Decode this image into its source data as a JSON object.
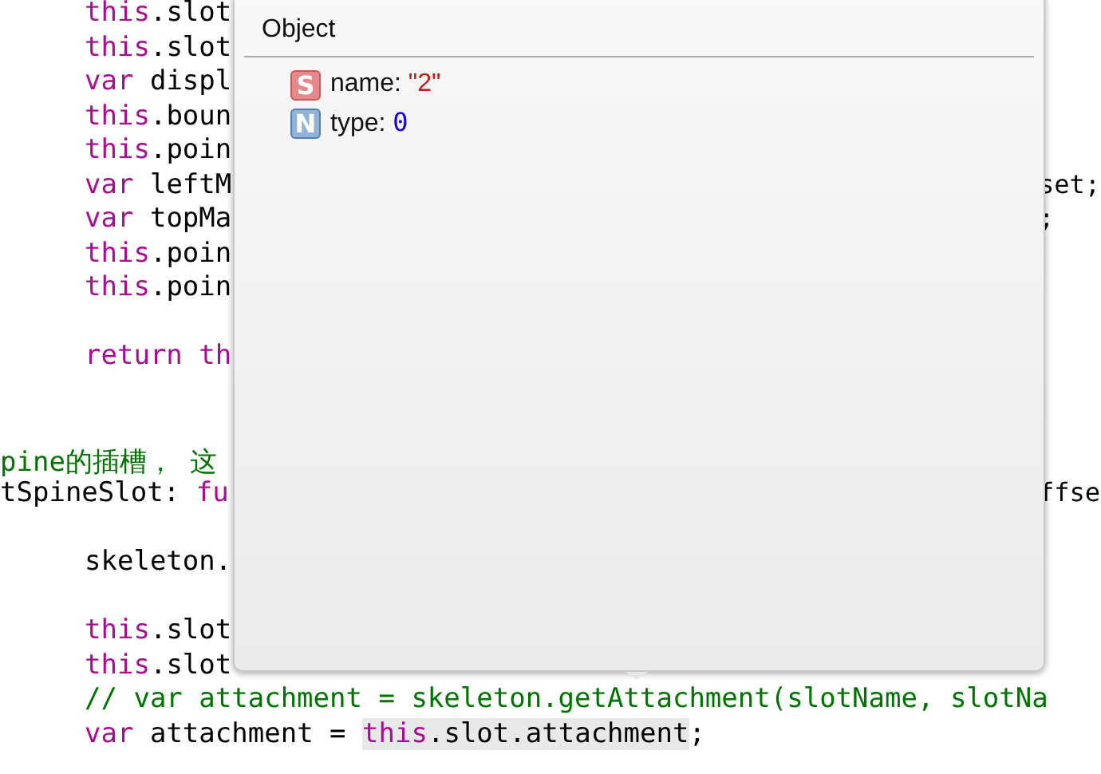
{
  "code_lines": [
    {
      "kind": "code",
      "indented": true,
      "tokens": [
        {
          "text": "this",
          "kind": "keyword"
        },
        {
          "text": ".slot",
          "kind": "plain"
        }
      ]
    },
    {
      "kind": "code",
      "indented": true,
      "tokens": [
        {
          "text": "this",
          "kind": "keyword"
        },
        {
          "text": ".slot",
          "kind": "plain"
        }
      ]
    },
    {
      "kind": "code",
      "indented": true,
      "tokens": [
        {
          "text": "var",
          "kind": "keyword"
        },
        {
          "text": " displ",
          "kind": "plain"
        }
      ]
    },
    {
      "kind": "code",
      "indented": true,
      "tokens": [
        {
          "text": "this",
          "kind": "keyword"
        },
        {
          "text": ".boun",
          "kind": "plain"
        }
      ]
    },
    {
      "kind": "code",
      "indented": true,
      "tokens": [
        {
          "text": "this",
          "kind": "keyword"
        },
        {
          "text": ".poin",
          "kind": "plain"
        }
      ]
    },
    {
      "kind": "code",
      "indented": true,
      "tokens": [
        {
          "text": "var",
          "kind": "keyword"
        },
        {
          "text": " leftM",
          "kind": "plain"
        }
      ],
      "right": "set;"
    },
    {
      "kind": "code",
      "indented": true,
      "tokens": [
        {
          "text": "var",
          "kind": "keyword"
        },
        {
          "text": " topMa",
          "kind": "plain"
        }
      ],
      "right": ";"
    },
    {
      "kind": "code",
      "indented": true,
      "tokens": [
        {
          "text": "this",
          "kind": "keyword"
        },
        {
          "text": ".poin",
          "kind": "plain"
        }
      ]
    },
    {
      "kind": "code",
      "indented": true,
      "tokens": [
        {
          "text": "this",
          "kind": "keyword"
        },
        {
          "text": ".poin",
          "kind": "plain"
        }
      ]
    },
    {
      "kind": "blank"
    },
    {
      "kind": "code",
      "indented": true,
      "tokens": [
        {
          "text": "return th",
          "kind": "keyword"
        }
      ]
    },
    {
      "kind": "blank"
    },
    {
      "kind": "blank"
    },
    {
      "kind": "code",
      "indented": false,
      "tokens": [
        {
          "text": "pine的插槽， 这",
          "kind": "comment"
        }
      ]
    },
    {
      "kind": "code",
      "indented": false,
      "tokens": [
        {
          "text": "tSpineSlot: ",
          "kind": "plain"
        },
        {
          "text": "fu",
          "kind": "keyword"
        }
      ],
      "right": "ffse"
    },
    {
      "kind": "blank"
    },
    {
      "kind": "code",
      "indented": true,
      "tokens": [
        {
          "text": "skeleton.",
          "kind": "plain"
        }
      ]
    },
    {
      "kind": "blank"
    },
    {
      "kind": "code",
      "indented": true,
      "tokens": [
        {
          "text": "this",
          "kind": "keyword"
        },
        {
          "text": ".slot",
          "kind": "plain"
        }
      ]
    },
    {
      "kind": "code",
      "indented": true,
      "tokens": [
        {
          "text": "this",
          "kind": "keyword"
        },
        {
          "text": ".slot",
          "kind": "plain"
        }
      ]
    },
    {
      "kind": "full",
      "indented": true,
      "tokens": [
        {
          "text": "// var attachment = skeleton.getAttachment(slotName, slotNa",
          "kind": "comment"
        }
      ]
    },
    {
      "kind": "full",
      "indented": true,
      "tokens": [
        {
          "text": "var",
          "kind": "keyword"
        },
        {
          "text": " attachment = ",
          "kind": "plain"
        },
        {
          "text": "this",
          "kind": "keyword_marked"
        },
        {
          "text": ".slot.attachment",
          "kind": "plain_marked"
        },
        {
          "text": ";",
          "kind": "plain"
        }
      ]
    }
  ],
  "popover": {
    "title": "Object",
    "properties": [
      {
        "kind": "string",
        "badge": "S",
        "key": "name:",
        "value": "\"2\""
      },
      {
        "kind": "number",
        "badge": "N",
        "key": "type:",
        "value": "0"
      }
    ]
  }
}
